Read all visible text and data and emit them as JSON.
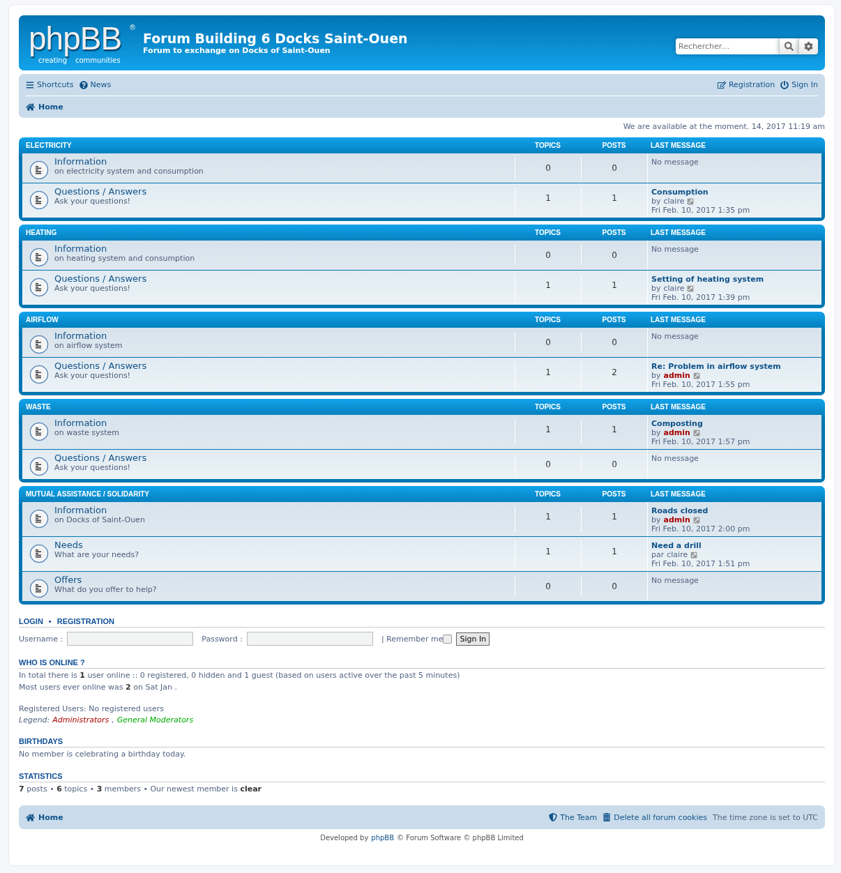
{
  "header": {
    "logo": {
      "word": "phpBB",
      "mark": "®",
      "tagline_left": "creating",
      "tagline_right": "communities"
    },
    "title": "Forum Building 6 Docks Saint-Ouen",
    "subtitle": "Forum to exchange on Docks of Saint-Ouen",
    "search": {
      "placeholder": "Rechercher…"
    }
  },
  "navbar": {
    "left": [
      {
        "kind": "menu",
        "label": "Shortcuts"
      },
      {
        "kind": "help",
        "label": "News"
      }
    ],
    "right": [
      {
        "kind": "edit",
        "label": "Registration"
      },
      {
        "kind": "power",
        "label": "Sign In"
      }
    ],
    "breadcrumb": "Home"
  },
  "status_line": "We are available at the moment. 14, 2017 11:19 am",
  "categories": [
    {
      "name": "ELECTRICITY",
      "columns": [
        "TOPICS",
        "POSTS",
        "LAST MESSAGE"
      ],
      "forums": [
        {
          "title": "Information",
          "description": "on electricity system and consumption",
          "topics": "0",
          "posts": "0",
          "last": {
            "none": "No message"
          }
        },
        {
          "title": "Questions / Answers",
          "description": "Ask your questions!",
          "topics": "1",
          "posts": "1",
          "last": {
            "subject": "Consumption",
            "prefix": "by",
            "author": "claire",
            "author_is_admin": false,
            "date": "Fri Feb. 10, 2017 1:35 pm"
          }
        }
      ]
    },
    {
      "name": "HEATING",
      "columns": [
        "TOPICS",
        "POSTS",
        "LAST MESSAGE"
      ],
      "forums": [
        {
          "title": "Information",
          "description": "on heating system and consumption",
          "topics": "0",
          "posts": "0",
          "last": {
            "none": "No message"
          }
        },
        {
          "title": "Questions / Answers",
          "description": "Ask your questions!",
          "topics": "1",
          "posts": "1",
          "last": {
            "subject": "Setting of heating system",
            "prefix": "by",
            "author": "claire",
            "author_is_admin": false,
            "date": "Fri Feb. 10, 2017 1:39 pm"
          }
        }
      ]
    },
    {
      "name": "AIRFLOW",
      "columns": [
        "TOPICS",
        "POSTS",
        "LAST MESSAGE"
      ],
      "forums": [
        {
          "title": "Information",
          "description": "on airflow system",
          "topics": "0",
          "posts": "0",
          "last": {
            "none": "No message"
          }
        },
        {
          "title": "Questions / Answers",
          "description": "Ask your questions!",
          "topics": "1",
          "posts": "2",
          "last": {
            "subject": "Re: Problem in airflow system",
            "prefix": "by",
            "author": "admin",
            "author_is_admin": true,
            "date": "Fri Feb. 10, 2017 1:55 pm"
          }
        }
      ]
    },
    {
      "name": "WASTE",
      "columns": [
        "TOPICS",
        "POSTS",
        "LAST MESSAGE"
      ],
      "forums": [
        {
          "title": "Information",
          "description": "on waste system",
          "topics": "1",
          "posts": "1",
          "last": {
            "subject": "Composting",
            "prefix": "by",
            "author": "admin",
            "author_is_admin": true,
            "date": "Fri Feb. 10, 2017 1:57 pm"
          }
        },
        {
          "title": "Questions / Answers",
          "description": "Ask your questions!",
          "topics": "0",
          "posts": "0",
          "last": {
            "none": "No message"
          }
        }
      ]
    },
    {
      "name": "MUTUAL ASSISTANCE / SOLIDARITY",
      "columns": [
        "TOPICS",
        "POSTS",
        "LAST MESSAGE"
      ],
      "forums": [
        {
          "title": "Information",
          "description": "on Docks of Saint-Ouen",
          "topics": "1",
          "posts": "1",
          "last": {
            "subject": "Roads closed",
            "prefix": "by",
            "author": "admin",
            "author_is_admin": true,
            "date": "Fri Feb. 10, 2017 2:00 pm"
          }
        },
        {
          "title": "Needs",
          "description": "What are your needs?",
          "topics": "1",
          "posts": "1",
          "last": {
            "subject": "Need a drill",
            "prefix": "par",
            "author": "claire",
            "author_is_admin": false,
            "date": "Fri Feb. 10, 2017 1:51 pm"
          }
        },
        {
          "title": "Offers",
          "description": "What do you offer to help?",
          "topics": "0",
          "posts": "0",
          "last": {
            "none": "No message"
          }
        }
      ]
    }
  ],
  "login": {
    "heading_left": "LOGIN",
    "separator": "•",
    "heading_right": "REGISTRATION",
    "username_label": "Username :",
    "password_label": "Password :",
    "remember_label": "| Remember me",
    "remember_checked": false,
    "submit": "Sign In"
  },
  "online": {
    "heading": "WHO IS ONLINE ?",
    "lines": [
      "In total there is **1** user online :: 0 registered, 0 hidden and 1 guest (based on users active over the past 5 minutes)",
      "Most users ever online was **2** on Sat Jan ."
    ],
    "registered": "Registered Users: No registered users",
    "legend_label": "Legend:",
    "legend": [
      {
        "label": "Administrators",
        "color": "#aa0000"
      },
      {
        "label": "General Moderators",
        "color": "#00aa00"
      }
    ],
    "legend_separator": ","
  },
  "birthdays": {
    "heading": "BIRTHDAYS",
    "text": "No member is celebrating a birthday today."
  },
  "statistics": {
    "heading": "STATISTICS",
    "text": "**7** posts • **6** topics • **3** members • Our newest member is **clear**"
  },
  "footer_nav": {
    "home": "Home",
    "links": [
      {
        "kind": "shield",
        "label": "The Team"
      },
      {
        "kind": "trash",
        "label": "Delete all forum cookies"
      }
    ],
    "timezone": "The time zone is set to UTC"
  },
  "credits": {
    "before": "Developed by",
    "link": "phpBB",
    "after": "© Forum Software © phpBB Limited"
  }
}
